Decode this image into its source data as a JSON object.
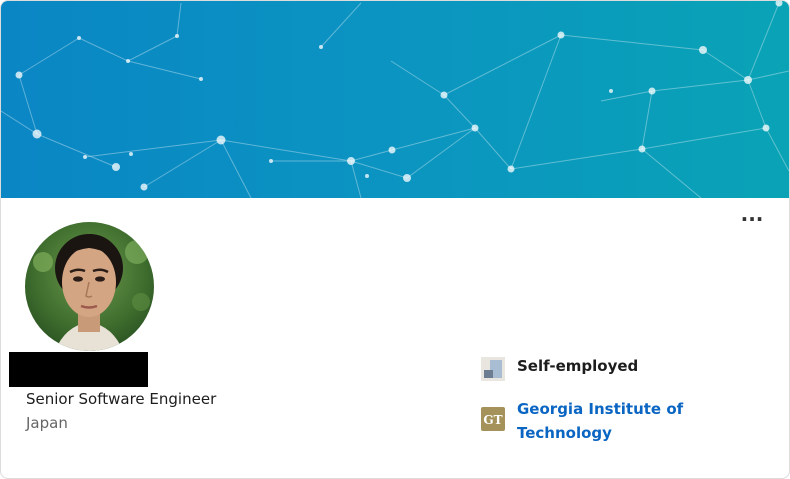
{
  "profile": {
    "headline": "Senior Software Engineer",
    "location": "Japan",
    "name_redacted": true
  },
  "actions": {
    "more_label": "…",
    "more_icon": "more-horizontal-icon"
  },
  "experience": {
    "company": "Self-employed",
    "company_icon": "company-placeholder-icon"
  },
  "education": {
    "school": "Georgia Institute of Technology",
    "school_logo": "georgia-tech-logo-icon",
    "school_logo_text": "GT"
  },
  "colors": {
    "banner_start": "#0a86c4",
    "banner_end": "#0aa3b6",
    "link": "#0a66c2",
    "gt_gold": "#a4925a"
  }
}
